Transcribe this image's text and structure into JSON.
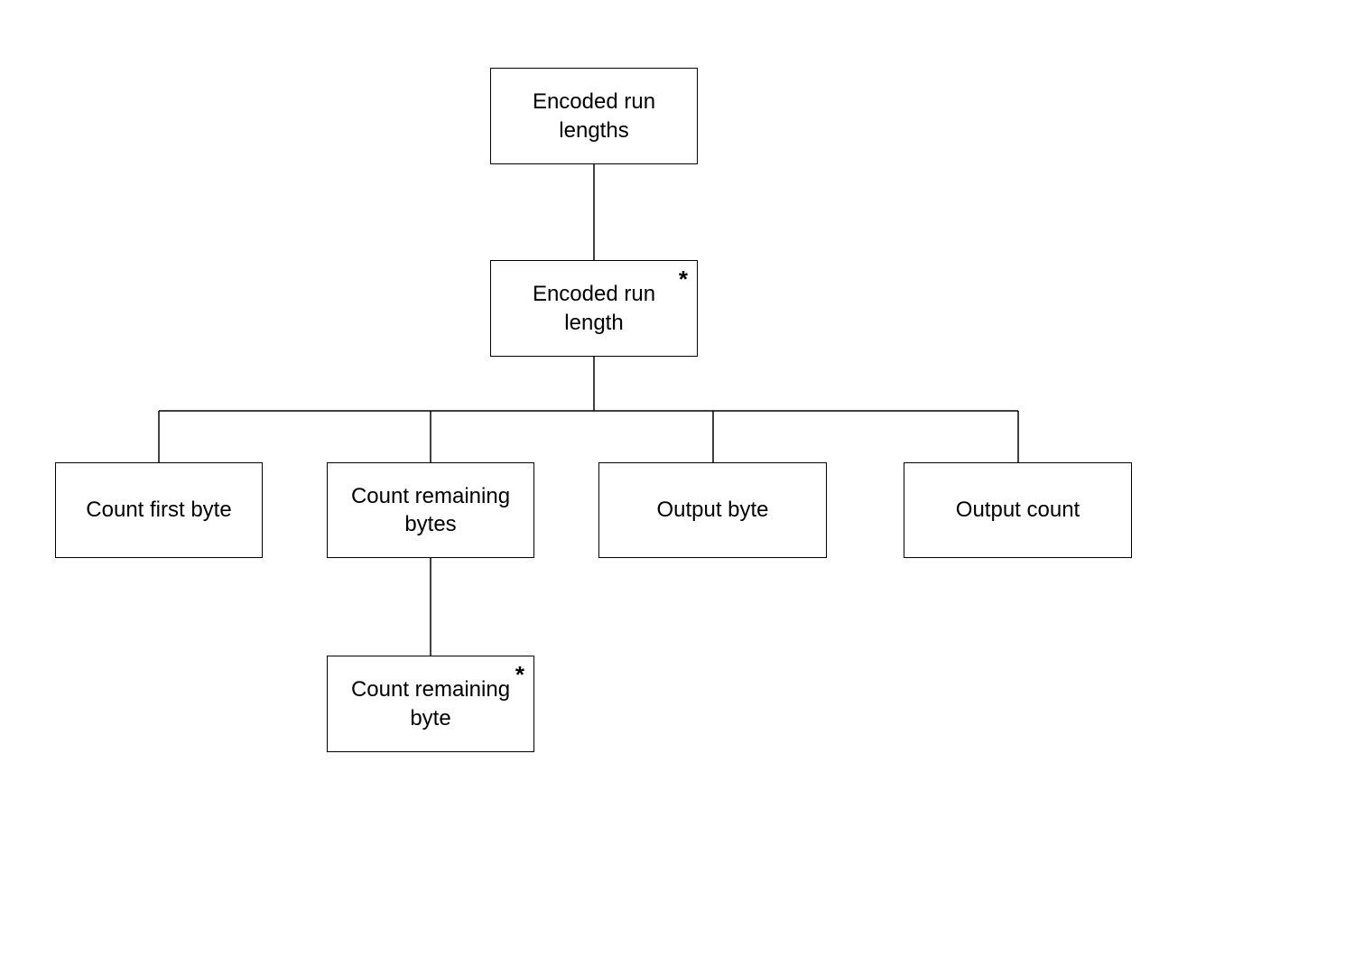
{
  "nodes": {
    "root": {
      "label": "Encoded run lengths",
      "marker": ""
    },
    "encoded_run_length": {
      "label": "Encoded run length",
      "marker": "*"
    },
    "count_first_byte": {
      "label": "Count first byte",
      "marker": ""
    },
    "count_remaining_bytes": {
      "label": "Count remaining bytes",
      "marker": ""
    },
    "output_byte": {
      "label": "Output byte",
      "marker": ""
    },
    "output_count": {
      "label": "Output count",
      "marker": ""
    },
    "count_remaining_byte": {
      "label": "Count remaining byte",
      "marker": "*"
    }
  }
}
